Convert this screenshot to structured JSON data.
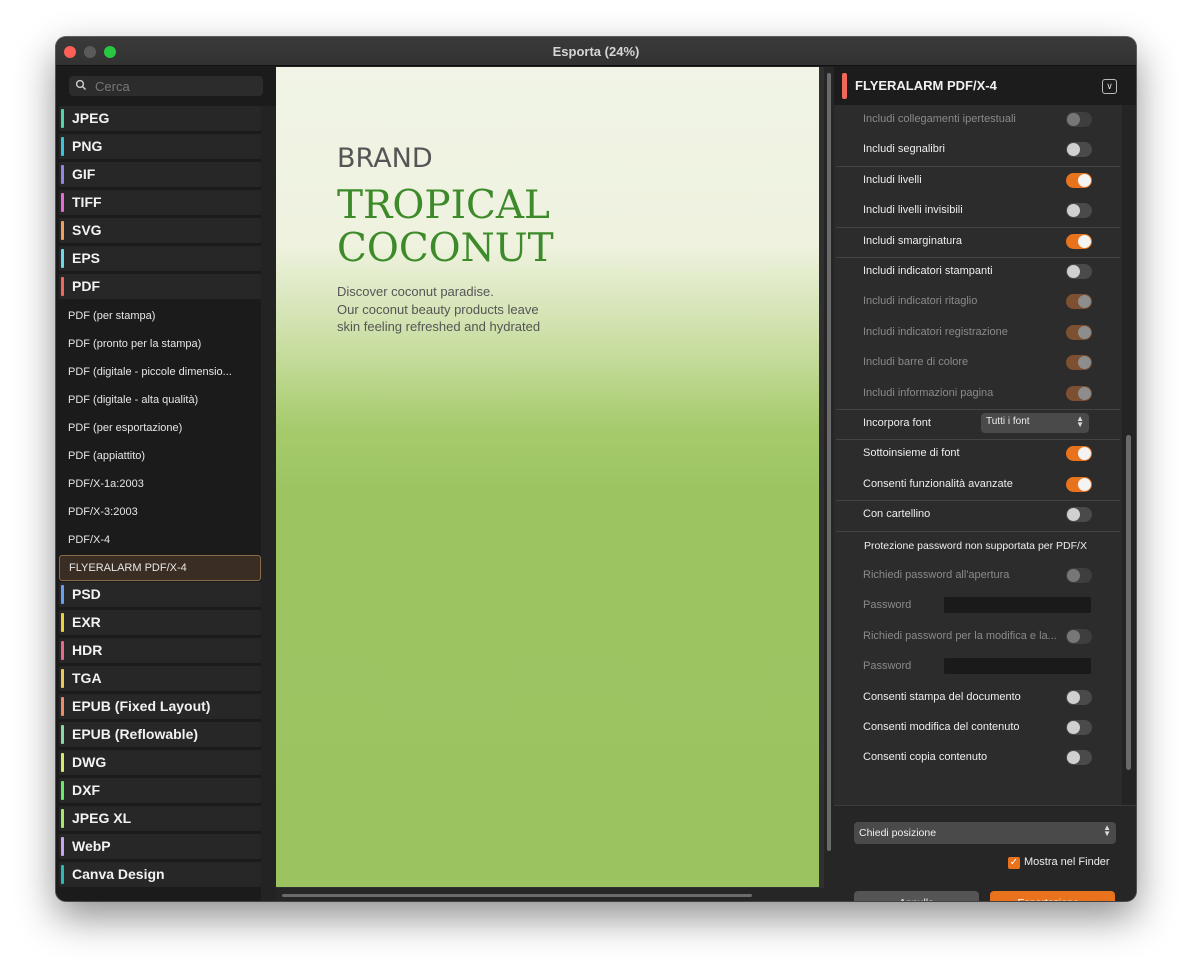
{
  "window": {
    "title": "Esporta (24%)"
  },
  "sidebar": {
    "search_placeholder": "Cerca",
    "formats_top": [
      {
        "label": "JPEG",
        "color": "#4cd9a6"
      },
      {
        "label": "PNG",
        "color": "#36c6d8"
      },
      {
        "label": "GIF",
        "color": "#8f86e8"
      },
      {
        "label": "TIFF",
        "color": "#e86ad2"
      },
      {
        "label": "SVG",
        "color": "#f0a25a"
      },
      {
        "label": "EPS",
        "color": "#6ad9e8"
      },
      {
        "label": "PDF",
        "color": "#f0685a"
      }
    ],
    "pdf_presets": [
      "PDF (per stampa)",
      "PDF (pronto per la stampa)",
      "PDF (digitale - piccole dimensio...",
      "PDF (digitale - alta qualità)",
      "PDF (per esportazione)",
      "PDF (appiattito)",
      "PDF/X-1a:2003",
      "PDF/X-3:2003",
      "PDF/X-4"
    ],
    "selected_preset": "FLYERALARM PDF/X-4",
    "formats_bottom": [
      {
        "label": "PSD",
        "color": "#6a9ef0"
      },
      {
        "label": "EXR",
        "color": "#e8d43a"
      },
      {
        "label": "HDR",
        "color": "#e86a8a"
      },
      {
        "label": "TGA",
        "color": "#f0c85a"
      },
      {
        "label": "EPUB (Fixed Layout)",
        "color": "#f08a6a"
      },
      {
        "label": "EPUB (Reflowable)",
        "color": "#8ad9a6"
      },
      {
        "label": "DWG",
        "color": "#d9e86a"
      },
      {
        "label": "DXF",
        "color": "#6ae86a"
      },
      {
        "label": "JPEG XL",
        "color": "#a6e86a"
      },
      {
        "label": "WebP",
        "color": "#c6a6f0"
      },
      {
        "label": "Canva Design",
        "color": "#2ab8b8"
      }
    ]
  },
  "preview": {
    "brand": "BRAND",
    "headline_1": "TROPICAL",
    "headline_2": "COCONUT",
    "tagline_1": "Discover coconut paradise.",
    "tagline_2": "Our coconut beauty products leave",
    "tagline_3": "skin feeling refreshed and hydrated"
  },
  "panel": {
    "title": "FLYERALARM PDF/X-4",
    "settings": [
      {
        "label": "Includi collegamenti ipertestuali",
        "state": "dimoff"
      },
      {
        "label": "Includi segnalibri",
        "state": "off"
      },
      {
        "label": "Includi livelli",
        "state": "on"
      },
      {
        "label": "Includi livelli invisibili",
        "state": "off"
      },
      {
        "label": "Includi smarginatura",
        "state": "on"
      },
      {
        "label": "Includi indicatori stampanti",
        "state": "off"
      },
      {
        "label": "Includi indicatori ritaglio",
        "state": "dimon"
      },
      {
        "label": "Includi indicatori registrazione",
        "state": "dimon"
      },
      {
        "label": "Includi barre di colore",
        "state": "dimon"
      },
      {
        "label": "Includi informazioni pagina",
        "state": "dimon"
      },
      {
        "label": "Incorpora font",
        "state": "select"
      },
      {
        "label": "Sottoinsieme di font",
        "state": "on"
      },
      {
        "label": "Consenti funzionalità avanzate",
        "state": "on"
      },
      {
        "label": "Con cartellino",
        "state": "off"
      }
    ],
    "embed_font_value": "Tutti i font",
    "password_note": "Protezione password non supportata per PDF/X",
    "password_rows": [
      {
        "label": "Richiedi password all'apertura",
        "state": "dimoff"
      },
      {
        "label": "Password",
        "state": "input"
      },
      {
        "label": "Richiedi password per la modifica e la...",
        "state": "dimoff"
      },
      {
        "label": "Password",
        "state": "input"
      }
    ],
    "permission_rows": [
      {
        "label": "Consenti stampa del documento",
        "state": "off"
      },
      {
        "label": "Consenti modifica del contenuto",
        "state": "off"
      },
      {
        "label": "Consenti copia contenuto",
        "state": "off"
      }
    ],
    "destination": "Chiedi posizione",
    "show_in_finder": "Mostra nel Finder",
    "cancel": "Annulla",
    "export": "Esportazione..."
  }
}
